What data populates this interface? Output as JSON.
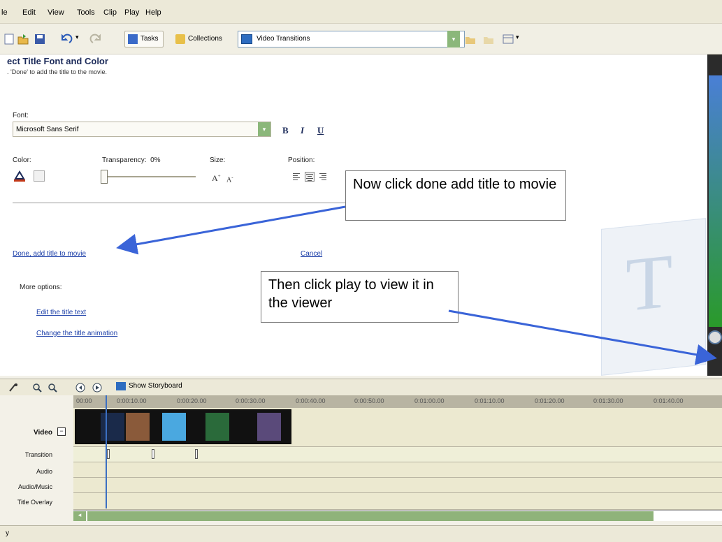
{
  "menu": [
    "le",
    "Edit",
    "View",
    "Tools",
    "Clip",
    "Play",
    "Help"
  ],
  "toolbar": {
    "tasks_label": "Tasks",
    "collections_label": "Collections",
    "collection_value": "Video Transitions"
  },
  "panel": {
    "title": "ect Title Font and Color",
    "subtitle": ". 'Done' to add the title to the movie.",
    "font_label": "Font:",
    "font_value": "Microsoft Sans Serif",
    "bold_label": "B",
    "italic_label": "I",
    "underline_label": "U",
    "color_label": "Color:",
    "transparency_label": "Transparency:",
    "transparency_value": "0%",
    "size_label": "Size:",
    "size_increase": "A",
    "size_decrease": "A",
    "position_label": "Position:",
    "done_link": "Done, add title to movie",
    "cancel_link": "Cancel",
    "more_options_label": "More options:",
    "edit_text_link": "Edit the title text",
    "change_animation_link": "Change the title animation"
  },
  "callouts": {
    "done": "Now click done add title to movie",
    "play": "Then click play to view it in the viewer"
  },
  "timeline": {
    "show_storyboard": "Show Storyboard",
    "ticks": [
      "00:00",
      "0:00:10.00",
      "0:00:20.00",
      "0:00:30.00",
      "0:00:40.00",
      "0:00:50.00",
      "0:01:00.00",
      "0:01:10.00",
      "0:01:20.00",
      "0:01:30.00",
      "0:01:40.00"
    ],
    "tracks": [
      "Video",
      "Transition",
      "Audio",
      "Audio/Music",
      "Title Overlay"
    ]
  },
  "status": {
    "text": "y"
  },
  "colors": {
    "link": "#1c3fa8",
    "arrow": "#3a64d8",
    "accent_green": "#8bb77a"
  }
}
